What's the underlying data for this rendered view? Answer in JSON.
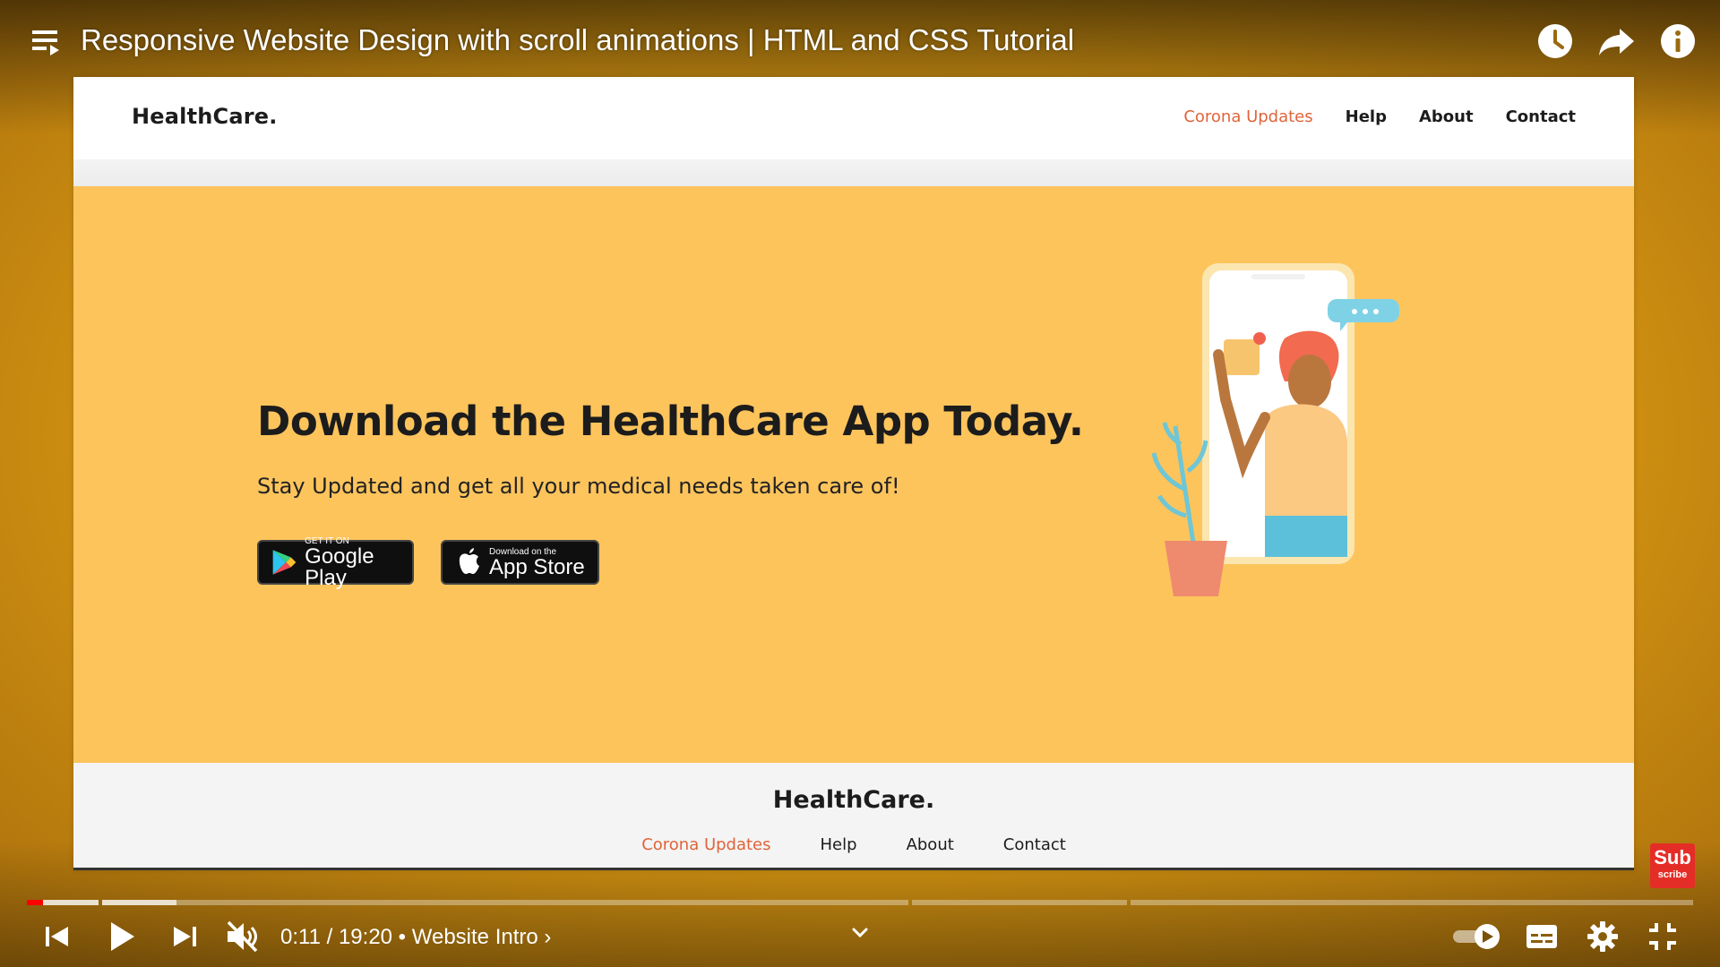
{
  "player": {
    "title": "Responsive Website Design with scroll animations | HTML and CSS Tutorial",
    "time_current": "0:11",
    "time_separator": " / ",
    "time_total": "19:20",
    "chapter_separator": " • ",
    "chapter": "Website Intro",
    "chapter_chevron": "›",
    "progress_fraction": 0.0095,
    "buffered_fraction": 0.09,
    "muted": true,
    "autoplay_on": true,
    "accent_color": "#ff0000",
    "icons": {
      "playlist": "playlist-icon",
      "watch_later": "clock-icon",
      "share": "share-icon",
      "info": "info-icon",
      "previous": "skip-previous-icon",
      "play": "play-icon",
      "next": "skip-next-icon",
      "volume": "volume-muted-icon",
      "expand": "chevron-down-icon",
      "autoplay": "autoplay-toggle-icon",
      "captions": "captions-icon",
      "settings": "gear-icon",
      "fullscreen": "exit-fullscreen-icon"
    }
  },
  "subscribe": {
    "line1": "Sub",
    "line2": "scribe",
    "color": "#e52d27"
  },
  "site": {
    "logo": "HealthCare.",
    "nav": [
      "Corona Updates",
      "Help",
      "About",
      "Contact"
    ],
    "nav_active_color": "#e0643a",
    "hero_title": "Download the HealthCare App Today.",
    "hero_subtitle": "Stay Updated and get all your medical needs taken care of!",
    "google_play": {
      "small": "GET IT ON",
      "big": "Google Play"
    },
    "app_store": {
      "small": "Download on the",
      "big": "App Store"
    },
    "background_color": "#fdc45c",
    "footer_logo": "HealthCare.",
    "footer_nav": [
      "Corona Updates",
      "Help",
      "About",
      "Contact"
    ]
  }
}
